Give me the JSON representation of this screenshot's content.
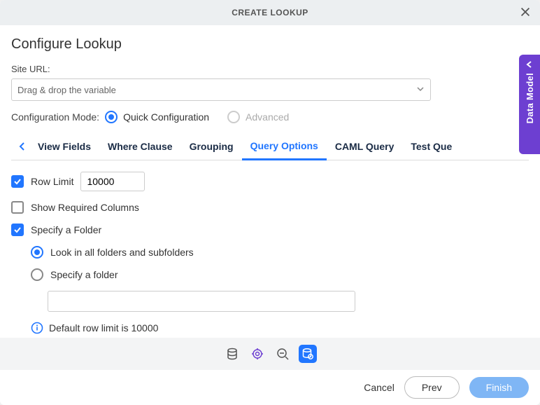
{
  "dialog": {
    "title": "CREATE LOOKUP",
    "heading": "Configure Lookup"
  },
  "site_url": {
    "label": "Site URL:",
    "placeholder": "Drag & drop the variable"
  },
  "config_mode": {
    "label": "Configuration Mode:",
    "quick_label": "Quick Configuration",
    "advanced_label": "Advanced",
    "selected": "quick"
  },
  "tabs": [
    {
      "label": "View Fields",
      "active": false
    },
    {
      "label": "Where Clause",
      "active": false
    },
    {
      "label": "Grouping",
      "active": false
    },
    {
      "label": "Query Options",
      "active": true
    },
    {
      "label": "CAML Query",
      "active": false
    },
    {
      "label": "Test Que",
      "active": false
    }
  ],
  "options": {
    "row_limit": {
      "checked": true,
      "label": "Row Limit",
      "value": "10000"
    },
    "show_required": {
      "checked": false,
      "label": "Show Required Columns"
    },
    "specify_folder": {
      "checked": true,
      "label": "Specify a Folder"
    },
    "folder_opts": {
      "look_all": {
        "selected": true,
        "label": "Look in all folders and subfolders"
      },
      "specify": {
        "selected": false,
        "label": "Specify a folder"
      }
    },
    "info_text": "Default row limit is 10000"
  },
  "footer": {
    "cancel": "Cancel",
    "prev": "Prev",
    "finish": "Finish"
  },
  "side_tab": {
    "label": "Data Model"
  }
}
